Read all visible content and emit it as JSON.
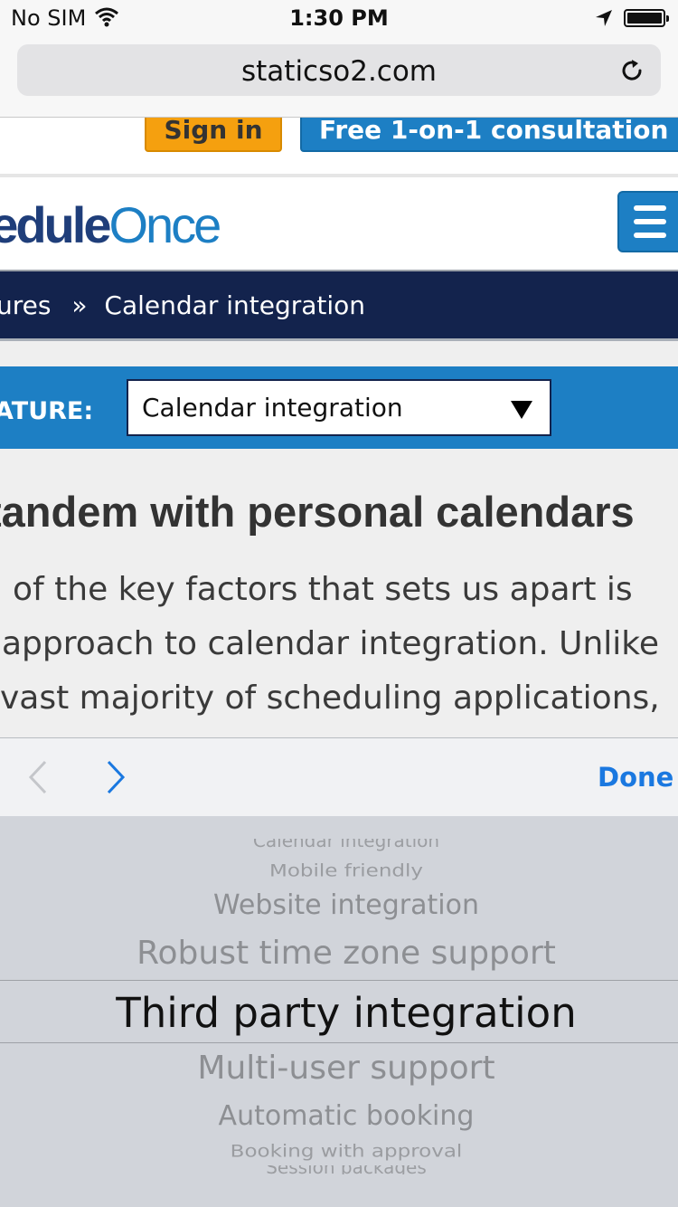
{
  "status_bar": {
    "carrier": "No SIM",
    "time": "1:30 PM",
    "icons": [
      "wifi-icon",
      "location-arrow-icon",
      "battery-icon"
    ]
  },
  "browser": {
    "url": "staticso2.com",
    "reload_icon": "reload-icon"
  },
  "site": {
    "signin_label": "Sign in",
    "consultation_label": "Free 1-on-1 consultation",
    "logo": {
      "part1": "neduleOnce",
      "dark": "nedule",
      "light": "Once"
    },
    "menu_icon": "hamburger-menu-icon",
    "breadcrumb": {
      "parent": "ures",
      "separator": "»",
      "current": "Calendar integration"
    },
    "feature_label": "ATURE:",
    "feature_select": {
      "selected": "Calendar integration"
    },
    "heading": "tandem with personal calendars",
    "paragraph_lines": [
      "of the key factors that sets us apart is",
      "approach to calendar integration. Unlike",
      "vast majority of scheduling applications,"
    ]
  },
  "keyboard_accessory": {
    "prev_icon": "chevron-left-icon",
    "next_icon": "chevron-right-icon",
    "done_label": "Done"
  },
  "picker": {
    "options": [
      "Calendar integration",
      "Mobile friendly",
      "Website integration",
      "Robust time zone support",
      "Third party integration",
      "Multi-user support",
      "Automatic booking",
      "Booking with approval",
      "Session packages"
    ],
    "selected": "Third party integration"
  },
  "colors": {
    "brand_blue": "#1d7fc4",
    "brand_navy": "#13234d",
    "signin_orange": "#f5a00f",
    "ios_blue": "#1a78e0"
  }
}
